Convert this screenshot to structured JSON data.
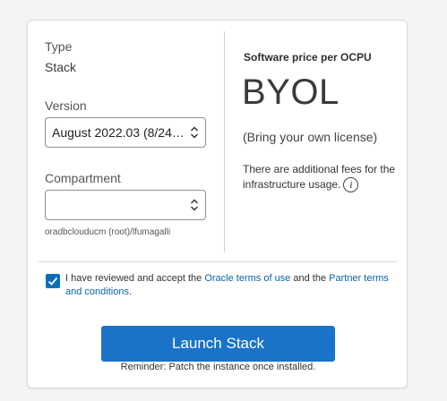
{
  "form": {
    "type_label": "Type",
    "type_value": "Stack",
    "version_label": "Version",
    "version_selected": "August 2022.03 (8/24/2022)",
    "compartment_label": "Compartment",
    "compartment_selected": "",
    "compartment_path": "oradbclouducm (root)/lfumagalli"
  },
  "pricing": {
    "title": "Software price per OCPU",
    "model": "BYOL",
    "model_description": "(Bring your own license)",
    "fees_note": "There are additional fees for the infrastructure usage.",
    "info_icon": "info-icon"
  },
  "terms": {
    "checked": true,
    "text_before": "I have reviewed and accept the ",
    "oracle_link": "Oracle terms of use",
    "text_middle": " and the ",
    "partner_link": "Partner terms and conditions",
    "text_after": "."
  },
  "actions": {
    "launch_label": "Launch Stack",
    "reminder": "Reminder: Patch the instance once installed."
  },
  "colors": {
    "accent": "#1a73c8",
    "link": "#0a63a8",
    "checkbox": "#0a6fb9"
  }
}
